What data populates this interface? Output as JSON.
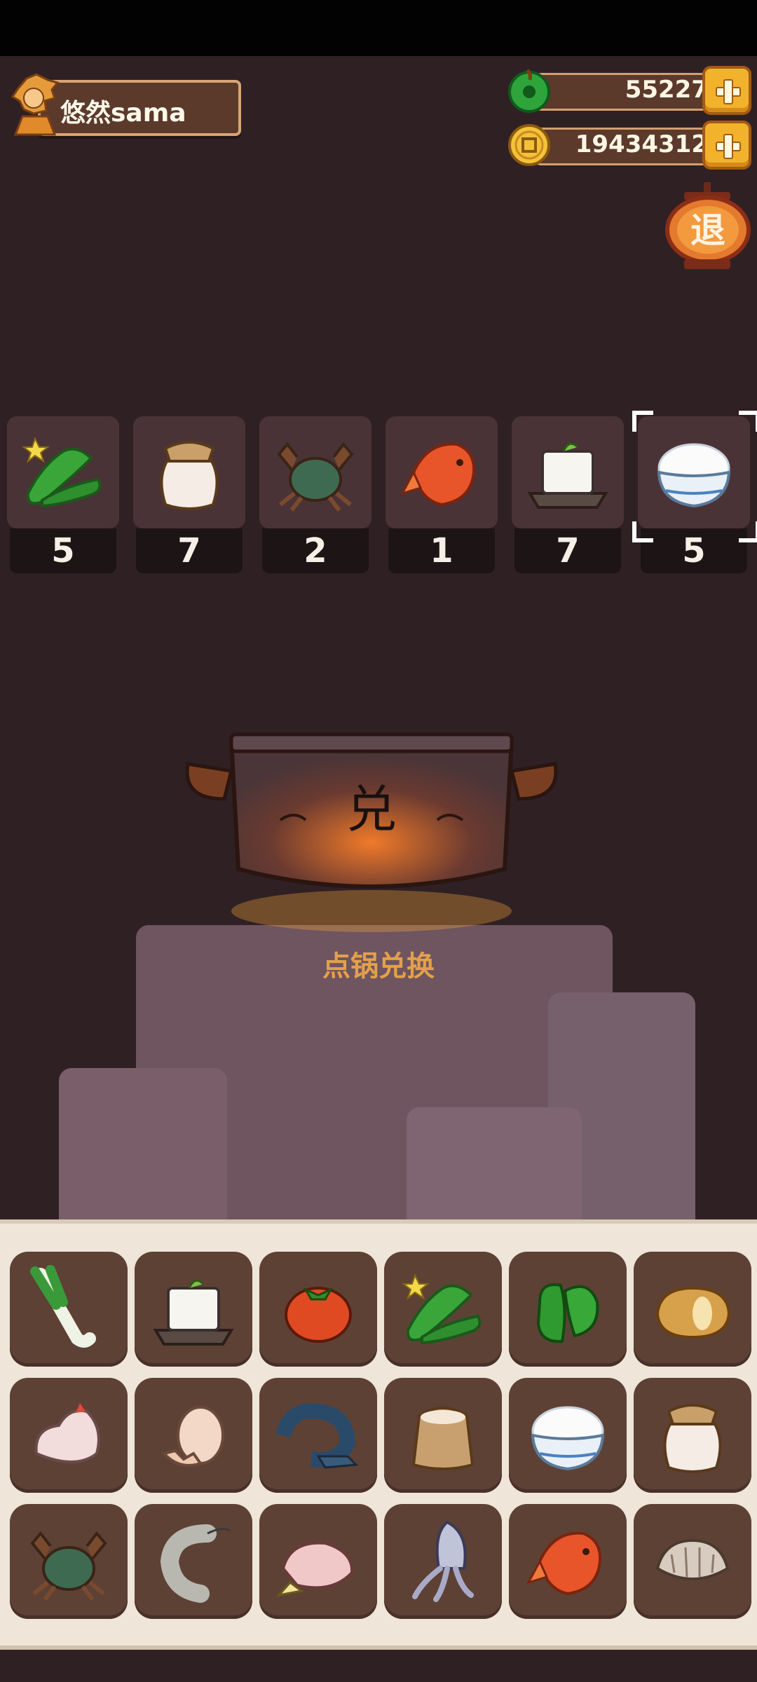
{
  "player": {
    "name": "悠然sama"
  },
  "currencies": {
    "jade": {
      "value": "55227",
      "icon": "jade-coin-icon"
    },
    "coins": {
      "value": "19434312",
      "icon": "gold-coin-icon"
    }
  },
  "exit_button": {
    "label": "退"
  },
  "recipe": [
    {
      "item": "cucumber",
      "count": "5"
    },
    {
      "item": "jar",
      "count": "7"
    },
    {
      "item": "crab",
      "count": "2"
    },
    {
      "item": "fish",
      "count": "1"
    },
    {
      "item": "tofu",
      "count": "7"
    },
    {
      "item": "rice",
      "count": "5",
      "selected": true
    }
  ],
  "pot": {
    "glyph": "兑",
    "hint": "点锅兑换"
  },
  "inventory": [
    "leek",
    "tofu",
    "tomato",
    "cucumber",
    "green-pepper",
    "potato",
    "chicken",
    "egg",
    "fish-dark",
    "flour-sack",
    "rice",
    "jar",
    "crab",
    "shrimp",
    "duck",
    "squid",
    "fish",
    "clam"
  ],
  "colors": {
    "background": "#2f2024",
    "accent": "#f2b22c",
    "hint": "#e3a04c",
    "inventory_bg": "#efe5d8"
  }
}
